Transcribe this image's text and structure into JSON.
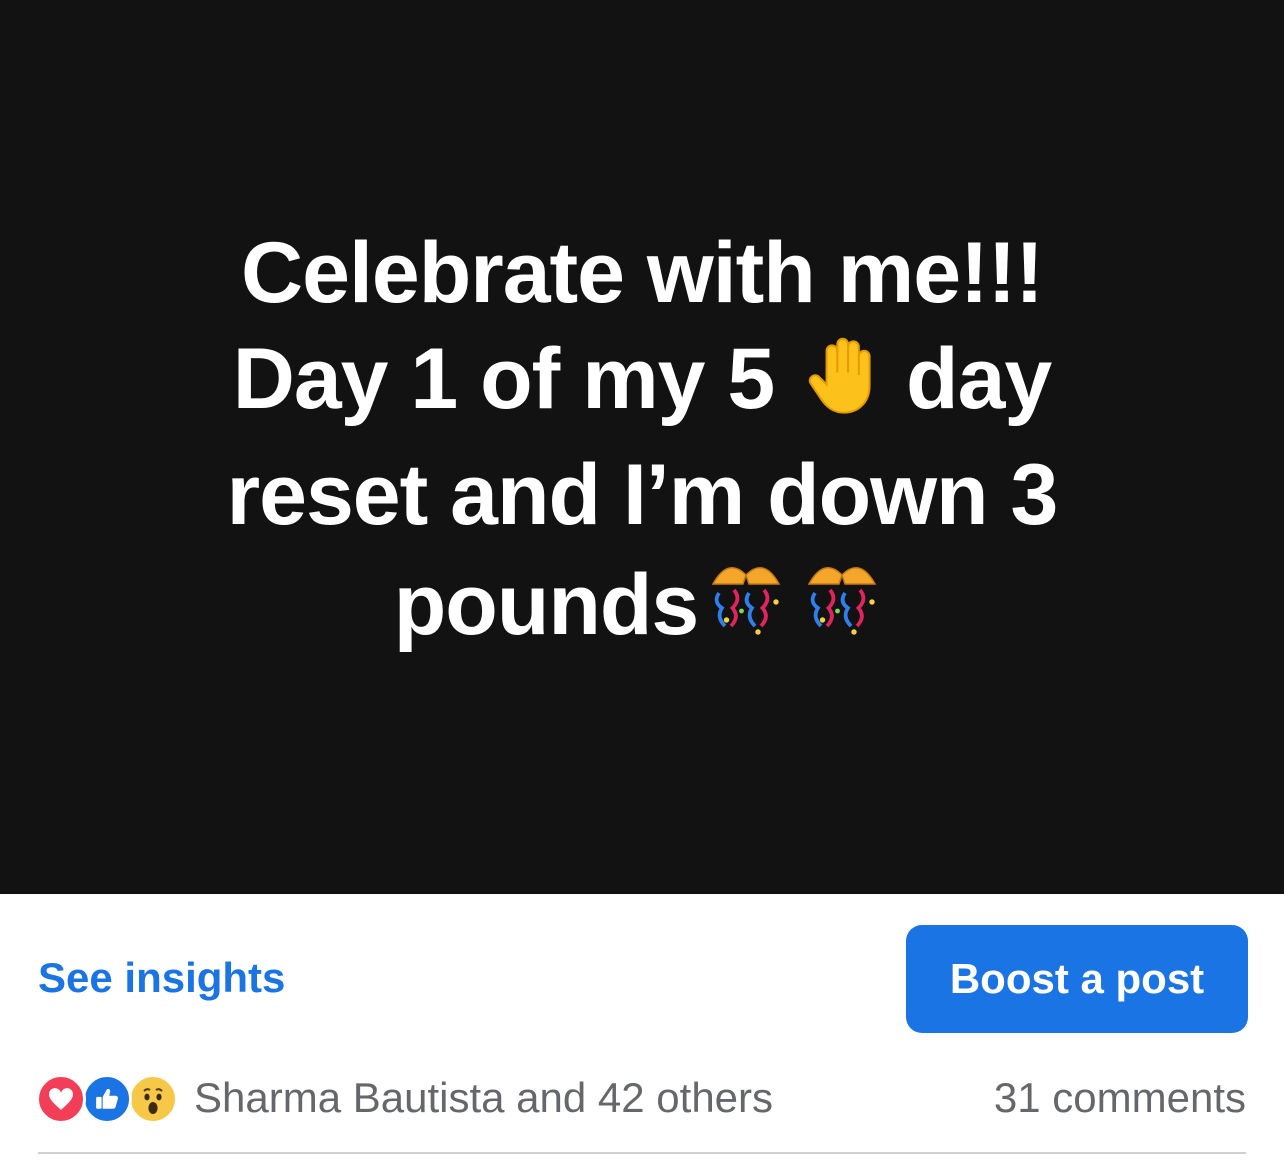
{
  "post": {
    "background_color": "#121212",
    "text_lines": [
      "Celebrate with me!!!",
      "Day 1 of my 5",
      "day",
      "reset and I’m down 3",
      "pounds"
    ],
    "hand_emoji": "raised-hand-emoji",
    "confetti_emoji": "confetti-ball-emoji"
  },
  "actions": {
    "insights_label": "See insights",
    "boost_label": "Boost a post",
    "accent_color": "#1b74e4"
  },
  "reactions": {
    "icons": [
      "love-reaction-icon",
      "like-reaction-icon",
      "wow-reaction-icon"
    ],
    "summary": "Sharma Bautista and 42 others",
    "comments": "31 comments"
  }
}
